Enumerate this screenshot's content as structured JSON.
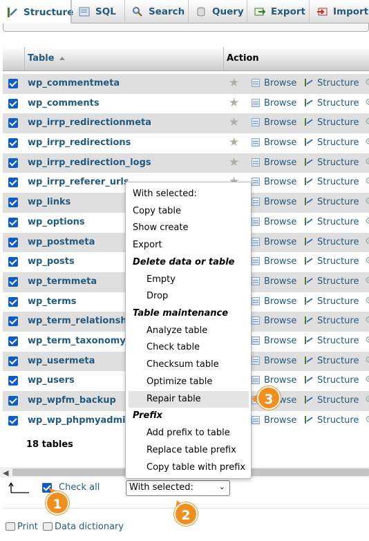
{
  "tabs": [
    {
      "label": "Structure",
      "icon": "structure-icon",
      "active": true
    },
    {
      "label": "SQL",
      "icon": "sql-icon"
    },
    {
      "label": "Search",
      "icon": "search-icon"
    },
    {
      "label": "Query",
      "icon": "query-icon"
    },
    {
      "label": "Export",
      "icon": "export-icon"
    },
    {
      "label": "Import",
      "icon": "import-icon"
    }
  ],
  "table_header": {
    "table": "Table",
    "action": "Action"
  },
  "actions": {
    "browse": "Browse",
    "structure": "Structure"
  },
  "tables": [
    "wp_commentmeta",
    "wp_comments",
    "wp_irrp_redirectionmeta",
    "wp_irrp_redirections",
    "wp_irrp_redirection_logs",
    "wp_irrp_referer_urls",
    "wp_links",
    "wp_options",
    "wp_postmeta",
    "wp_posts",
    "wp_termmeta",
    "wp_terms",
    "wp_term_relationships",
    "wp_term_taxonomy",
    "wp_usermeta",
    "wp_users",
    "wp_wpfm_backup",
    "wp_wp_phpmyadmin_e"
  ],
  "table_count": "18 tables",
  "footer": {
    "check_all": "Check all",
    "with_selected": "With selected:",
    "print": "Print",
    "data_dictionary": "Data dictionary"
  },
  "menu": {
    "header": "With selected:",
    "items_top": [
      "Copy table",
      "Show create",
      "Export"
    ],
    "group_delete": "Delete data or table",
    "items_delete": [
      "Empty",
      "Drop"
    ],
    "group_maintenance": "Table maintenance",
    "items_maintenance": [
      "Analyze table",
      "Check table",
      "Checksum table",
      "Optimize table",
      "Repair table"
    ],
    "group_prefix": "Prefix",
    "items_prefix": [
      "Add prefix to table",
      "Replace table prefix",
      "Copy table with prefix"
    ],
    "highlighted": "Repair table"
  },
  "callouts": [
    "1",
    "2",
    "3"
  ],
  "colors": {
    "link": "#235a81",
    "badge": "#f08f1e",
    "checkbox": "#0f5cc7"
  }
}
